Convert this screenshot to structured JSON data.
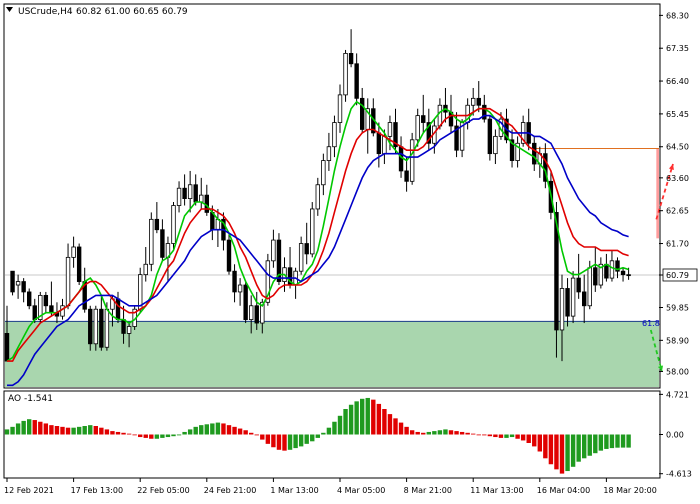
{
  "chart_data": {
    "type": "candlestick",
    "symbol_title": "USCrude,H4",
    "ohlc_readout": "60.82 61.00 60.65 60.79",
    "price_axis": {
      "ylim": [
        57.55,
        68.6
      ],
      "ticks": [
        "68.30",
        "67.35",
        "66.40",
        "65.45",
        "64.50",
        "63.60",
        "62.65",
        "61.70",
        "60.79",
        "59.85",
        "58.90",
        "58.00"
      ],
      "tick_values": [
        68.3,
        67.35,
        66.4,
        65.45,
        64.5,
        63.6,
        62.65,
        61.7,
        60.79,
        59.85,
        58.9,
        58.0
      ]
    },
    "x_axis": {
      "tick_labels": [
        "12 Feb 2021",
        "17 Feb 13:00",
        "22 Feb 05:00",
        "24 Feb 21:00",
        "1 Mar 13:00",
        "4 Mar 05:00",
        "8 Mar 21:00",
        "11 Mar 13:00",
        "16 Mar 04:00",
        "18 Mar 20:00"
      ],
      "tick_index": [
        0,
        12,
        24,
        36,
        48,
        60,
        72,
        84,
        96,
        108
      ]
    },
    "current_price": 60.79,
    "fib_label": "61.8",
    "fib_level": 59.45,
    "zones": {
      "support_top": 59.45,
      "support_bottom": 57.55,
      "resistance_top": 64.45,
      "resistance_bottom": 61.85,
      "resistance_start_index": 117,
      "resistance_band_start_index": 95
    },
    "candles": [
      [
        59.1,
        59.9,
        58.3,
        58.3
      ],
      [
        60.9,
        60.9,
        60.2,
        60.3
      ],
      [
        60.5,
        60.8,
        60.1,
        60.6
      ],
      [
        60.6,
        60.7,
        60.0,
        60.3
      ],
      [
        60.3,
        60.4,
        59.8,
        59.9
      ],
      [
        59.9,
        60.1,
        59.4,
        59.5
      ],
      [
        59.5,
        60.3,
        59.4,
        60.2
      ],
      [
        60.2,
        60.3,
        59.7,
        59.9
      ],
      [
        59.9,
        60.6,
        59.6,
        59.7
      ],
      [
        59.7,
        60.0,
        59.4,
        59.6
      ],
      [
        59.6,
        60.1,
        59.5,
        59.9
      ],
      [
        59.9,
        61.7,
        59.8,
        61.3
      ],
      [
        61.3,
        61.9,
        61.0,
        61.6
      ],
      [
        61.6,
        61.7,
        60.5,
        60.6
      ],
      [
        60.6,
        61.0,
        59.7,
        59.8
      ],
      [
        59.8,
        59.9,
        58.6,
        58.8
      ],
      [
        58.8,
        59.9,
        58.6,
        59.8
      ],
      [
        59.8,
        60.2,
        58.6,
        58.7
      ],
      [
        58.7,
        60.0,
        58.6,
        59.8
      ],
      [
        59.8,
        60.2,
        59.3,
        60.1
      ],
      [
        60.1,
        60.3,
        59.4,
        59.5
      ],
      [
        59.5,
        59.9,
        58.8,
        59.1
      ],
      [
        59.1,
        59.4,
        58.7,
        59.3
      ],
      [
        59.3,
        59.9,
        59.2,
        59.8
      ],
      [
        59.8,
        61.0,
        59.7,
        60.8
      ],
      [
        60.8,
        61.6,
        60.6,
        61.1
      ],
      [
        61.1,
        62.6,
        60.9,
        62.4
      ],
      [
        62.4,
        62.9,
        62.0,
        62.1
      ],
      [
        62.1,
        62.4,
        61.2,
        61.3
      ],
      [
        61.3,
        61.9,
        60.6,
        61.7
      ],
      [
        61.7,
        62.9,
        61.5,
        62.8
      ],
      [
        62.8,
        63.5,
        62.6,
        63.3
      ],
      [
        63.3,
        63.7,
        62.8,
        63.0
      ],
      [
        63.0,
        63.8,
        62.6,
        63.4
      ],
      [
        63.4,
        63.7,
        62.8,
        62.9
      ],
      [
        62.9,
        63.6,
        62.7,
        63.1
      ],
      [
        63.1,
        63.4,
        62.5,
        62.6
      ],
      [
        62.6,
        62.8,
        61.8,
        62.1
      ],
      [
        62.1,
        62.7,
        61.6,
        62.4
      ],
      [
        62.4,
        62.6,
        61.5,
        61.8
      ],
      [
        61.8,
        62.0,
        60.8,
        60.9
      ],
      [
        60.9,
        61.1,
        60.0,
        60.3
      ],
      [
        60.3,
        60.7,
        59.9,
        60.5
      ],
      [
        60.5,
        60.6,
        59.4,
        59.5
      ],
      [
        59.5,
        60.2,
        59.1,
        59.9
      ],
      [
        59.9,
        60.3,
        59.2,
        59.4
      ],
      [
        59.4,
        60.1,
        59.1,
        60.0
      ],
      [
        60.0,
        61.4,
        59.9,
        61.2
      ],
      [
        61.2,
        62.1,
        61.0,
        61.8
      ],
      [
        61.8,
        62.0,
        60.5,
        60.6
      ],
      [
        60.6,
        61.3,
        60.3,
        61.0
      ],
      [
        61.0,
        61.6,
        60.4,
        60.5
      ],
      [
        60.5,
        61.0,
        60.1,
        60.9
      ],
      [
        60.9,
        61.9,
        60.8,
        61.7
      ],
      [
        61.7,
        62.3,
        61.1,
        61.4
      ],
      [
        61.4,
        62.9,
        61.3,
        62.7
      ],
      [
        62.7,
        63.6,
        62.5,
        63.4
      ],
      [
        63.4,
        64.3,
        63.1,
        64.1
      ],
      [
        64.1,
        64.9,
        63.8,
        64.5
      ],
      [
        64.5,
        65.4,
        64.2,
        65.2
      ],
      [
        65.2,
        66.3,
        64.9,
        66.0
      ],
      [
        66.0,
        67.3,
        65.8,
        67.2
      ],
      [
        67.2,
        67.9,
        66.8,
        66.9
      ],
      [
        66.9,
        67.2,
        65.7,
        65.9
      ],
      [
        65.9,
        66.2,
        64.9,
        65.0
      ],
      [
        65.0,
        65.9,
        64.3,
        65.6
      ],
      [
        65.6,
        65.9,
        64.8,
        64.9
      ],
      [
        64.9,
        65.2,
        63.9,
        64.3
      ],
      [
        64.3,
        65.0,
        64.0,
        64.8
      ],
      [
        64.8,
        65.4,
        64.4,
        65.2
      ],
      [
        65.2,
        65.6,
        64.3,
        64.5
      ],
      [
        64.5,
        64.8,
        63.6,
        63.8
      ],
      [
        63.8,
        64.2,
        63.2,
        63.5
      ],
      [
        63.5,
        64.9,
        63.4,
        64.7
      ],
      [
        64.7,
        65.6,
        64.5,
        65.4
      ],
      [
        65.4,
        66.0,
        64.9,
        65.2
      ],
      [
        65.2,
        65.6,
        64.4,
        64.6
      ],
      [
        64.6,
        65.3,
        64.3,
        65.1
      ],
      [
        65.1,
        65.9,
        65.0,
        65.7
      ],
      [
        65.7,
        66.2,
        65.2,
        65.5
      ],
      [
        65.5,
        66.0,
        64.9,
        65.1
      ],
      [
        65.1,
        65.5,
        64.2,
        64.4
      ],
      [
        64.4,
        65.3,
        64.2,
        65.2
      ],
      [
        65.2,
        65.9,
        65.0,
        65.7
      ],
      [
        65.7,
        66.2,
        65.4,
        65.9
      ],
      [
        65.9,
        66.4,
        65.5,
        65.7
      ],
      [
        65.7,
        66.0,
        65.2,
        65.3
      ],
      [
        65.3,
        65.4,
        64.1,
        64.3
      ],
      [
        64.3,
        65.0,
        64.0,
        64.8
      ],
      [
        64.8,
        65.5,
        64.7,
        65.3
      ],
      [
        65.3,
        65.6,
        64.6,
        64.7
      ],
      [
        64.7,
        65.0,
        63.9,
        64.1
      ],
      [
        64.1,
        64.8,
        63.9,
        64.6
      ],
      [
        64.6,
        65.4,
        64.5,
        65.2
      ],
      [
        65.2,
        65.6,
        64.4,
        64.6
      ],
      [
        64.6,
        64.8,
        63.8,
        64.0
      ],
      [
        64.0,
        64.5,
        63.6,
        64.3
      ],
      [
        64.3,
        64.6,
        63.3,
        63.5
      ],
      [
        63.5,
        63.8,
        62.4,
        62.6
      ],
      [
        62.6,
        62.9,
        58.4,
        59.2
      ],
      [
        59.2,
        60.8,
        58.3,
        60.4
      ],
      [
        60.4,
        60.7,
        59.3,
        59.6
      ],
      [
        59.6,
        60.9,
        59.4,
        60.7
      ],
      [
        60.7,
        61.4,
        60.1,
        60.3
      ],
      [
        60.3,
        60.8,
        59.4,
        59.9
      ],
      [
        59.9,
        61.2,
        59.8,
        61.0
      ],
      [
        61.0,
        61.6,
        60.3,
        60.5
      ],
      [
        60.5,
        61.3,
        60.4,
        61.1
      ],
      [
        61.1,
        61.4,
        60.6,
        60.7
      ],
      [
        60.7,
        61.5,
        60.6,
        61.2
      ],
      [
        61.2,
        61.3,
        60.7,
        60.9
      ],
      [
        60.9,
        61.0,
        60.6,
        60.8
      ],
      [
        60.8,
        61.0,
        60.65,
        60.79
      ]
    ],
    "moving_averages": [
      {
        "color": "#00c800",
        "values": [
          58.3,
          58.4,
          58.7,
          59.0,
          59.3,
          59.5,
          59.6,
          59.7,
          59.7,
          59.7,
          59.8,
          59.9,
          60.1,
          60.3,
          60.6,
          60.7,
          60.5,
          60.2,
          59.8,
          59.6,
          59.5,
          59.5,
          59.4,
          59.5,
          59.7,
          59.9,
          60.2,
          60.8,
          61.2,
          61.3,
          61.5,
          62.0,
          62.5,
          62.7,
          62.9,
          62.9,
          62.8,
          62.6,
          62.4,
          62.3,
          62.0,
          61.6,
          61.0,
          60.6,
          60.3,
          60.0,
          59.9,
          60.2,
          60.6,
          60.8,
          60.8,
          60.6,
          60.5,
          60.6,
          60.9,
          61.1,
          61.5,
          62.2,
          63.0,
          63.8,
          64.5,
          65.1,
          65.6,
          65.8,
          65.7,
          65.5,
          65.3,
          65.1,
          64.9,
          64.6,
          64.4,
          64.2,
          64.1,
          64.3,
          64.6,
          64.9,
          65.1,
          65.3,
          65.5,
          65.6,
          65.5,
          65.3,
          65.2,
          65.3,
          65.5,
          65.6,
          65.6,
          65.5,
          65.3,
          65.0,
          64.8,
          64.6,
          64.5,
          64.4,
          64.3,
          64.2,
          64.0,
          63.8,
          63.1,
          62.3,
          61.5,
          60.9,
          60.8,
          60.8,
          60.9,
          61.0,
          61.1,
          61.0,
          61.1,
          61.0,
          60.95,
          61.0,
          60.95
        ]
      },
      {
        "color": "#e00000",
        "values": [
          58.3,
          58.3,
          58.6,
          58.8,
          59.0,
          59.2,
          59.4,
          59.5,
          59.6,
          59.7,
          59.8,
          59.9,
          60.1,
          60.3,
          60.5,
          60.6,
          60.6,
          60.5,
          60.3,
          60.1,
          59.9,
          59.8,
          59.7,
          59.7,
          59.8,
          59.9,
          60.1,
          60.4,
          60.7,
          61.0,
          61.2,
          61.6,
          62.0,
          62.3,
          62.5,
          62.7,
          62.7,
          62.7,
          62.6,
          62.5,
          62.3,
          62.0,
          61.6,
          61.3,
          60.9,
          60.5,
          60.2,
          60.1,
          60.2,
          60.4,
          60.5,
          60.5,
          60.5,
          60.5,
          60.6,
          60.8,
          61.1,
          61.5,
          62.0,
          62.6,
          63.2,
          63.8,
          64.3,
          64.7,
          64.9,
          65.0,
          65.0,
          64.9,
          64.8,
          64.7,
          64.6,
          64.5,
          64.4,
          64.4,
          64.4,
          64.5,
          64.7,
          64.9,
          65.1,
          65.3,
          65.4,
          65.4,
          65.4,
          65.4,
          65.5,
          65.6,
          65.6,
          65.6,
          65.5,
          65.4,
          65.2,
          65.1,
          64.9,
          64.7,
          64.5,
          64.4,
          64.3,
          64.1,
          63.8,
          63.3,
          62.8,
          62.3,
          61.9,
          61.7,
          61.6,
          61.6,
          61.6,
          61.5,
          61.5,
          61.5,
          61.5,
          61.4,
          61.35
        ]
      },
      {
        "color": "#0000c8",
        "values": [
          57.6,
          57.6,
          57.7,
          57.9,
          58.2,
          58.5,
          58.7,
          58.9,
          59.1,
          59.3,
          59.4,
          59.5,
          59.7,
          59.9,
          60.0,
          60.1,
          60.2,
          60.2,
          60.2,
          60.2,
          60.1,
          60.0,
          59.9,
          59.9,
          59.9,
          60.0,
          60.1,
          60.2,
          60.4,
          60.6,
          60.8,
          61.0,
          61.2,
          61.5,
          61.7,
          61.9,
          62.0,
          62.1,
          62.1,
          62.1,
          62.0,
          61.9,
          61.8,
          61.6,
          61.4,
          61.2,
          61.0,
          60.8,
          60.7,
          60.7,
          60.7,
          60.7,
          60.7,
          60.6,
          60.7,
          60.8,
          60.9,
          61.1,
          61.3,
          61.6,
          62.0,
          62.4,
          62.8,
          63.2,
          63.6,
          63.9,
          64.1,
          64.2,
          64.3,
          64.3,
          64.3,
          64.3,
          64.2,
          64.2,
          64.2,
          64.3,
          64.4,
          64.5,
          64.7,
          64.8,
          64.9,
          65.0,
          65.1,
          65.2,
          65.3,
          65.3,
          65.4,
          65.4,
          65.3,
          65.2,
          65.0,
          64.9,
          64.9,
          64.9,
          64.9,
          64.8,
          64.8,
          64.7,
          64.6,
          64.3,
          64.0,
          63.6,
          63.3,
          63.0,
          62.8,
          62.6,
          62.5,
          62.3,
          62.2,
          62.1,
          62.05,
          61.95,
          61.9
        ]
      }
    ],
    "arrows": [
      {
        "color": "#ff3030",
        "from": [
          117,
          62.4
        ],
        "to": [
          120,
          64.0
        ]
      },
      {
        "color": "#22c822",
        "from": [
          116,
          59.2
        ],
        "to": [
          118,
          58.0
        ]
      }
    ],
    "oscillator": {
      "label": "AO -1.541",
      "ylim": [
        -5.0,
        5.0
      ],
      "ticks": [
        "4.721",
        "0.00",
        "-4.613"
      ],
      "tick_values": [
        4.721,
        0.0,
        -4.613
      ],
      "values": [
        0.6,
        0.9,
        1.3,
        1.6,
        1.8,
        1.7,
        1.5,
        1.3,
        1.1,
        1.0,
        0.9,
        0.8,
        0.8,
        0.9,
        1.0,
        1.1,
        1.0,
        0.8,
        0.6,
        0.4,
        0.3,
        0.2,
        0.1,
        0.0,
        -0.3,
        -0.4,
        -0.5,
        -0.5,
        -0.4,
        -0.3,
        -0.2,
        -0.1,
        0.3,
        0.6,
        0.9,
        1.1,
        1.2,
        1.3,
        1.4,
        1.3,
        1.1,
        0.9,
        0.7,
        0.5,
        0.2,
        -0.1,
        -0.6,
        -1.1,
        -1.5,
        -1.8,
        -1.9,
        -1.8,
        -1.6,
        -1.4,
        -1.1,
        -0.8,
        -0.4,
        0.2,
        0.8,
        1.5,
        2.2,
        3.0,
        3.5,
        3.9,
        4.2,
        4.3,
        4.1,
        3.6,
        3.0,
        2.4,
        1.9,
        1.4,
        0.9,
        0.5,
        0.3,
        0.2,
        0.3,
        0.4,
        0.5,
        0.6,
        0.5,
        0.4,
        0.3,
        0.2,
        0.1,
        0.0,
        -0.1,
        -0.2,
        -0.3,
        -0.4,
        -0.4,
        -0.3,
        -0.5,
        -0.7,
        -1.0,
        -1.4,
        -2.0,
        -2.8,
        -3.5,
        -4.1,
        -4.6,
        -4.3,
        -3.8,
        -3.2,
        -2.8,
        -2.5,
        -2.2,
        -1.9,
        -1.7,
        -1.6,
        -1.55,
        -1.541,
        -1.541
      ]
    }
  }
}
